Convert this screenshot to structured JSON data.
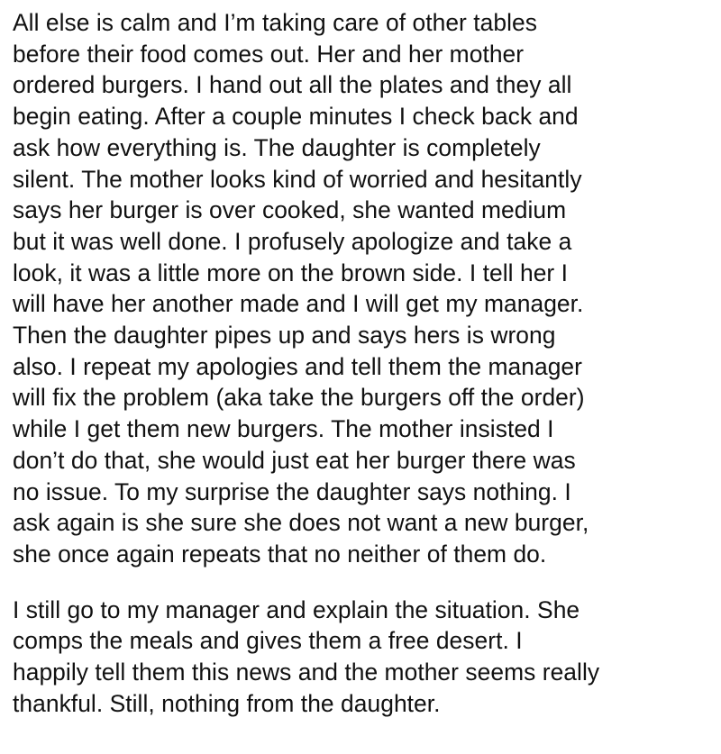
{
  "paragraphs": [
    {
      "lines": [
        "All else is calm and I’m taking care of other tables",
        "before their food comes out. Her and her mother",
        "ordered burgers. I hand out all the plates and they all",
        "begin eating. After a couple minutes I check back and",
        "ask how everything is. The daughter is completely",
        "silent. The mother looks kind of worried and hesitantly",
        "says her burger is over cooked, she wanted medium",
        "but it was well done. I profusely apologize and take a",
        "look, it was a little more on the brown side. I tell her I",
        "will have her another made and I will get my manager.",
        "Then the daughter pipes up and says hers is wrong",
        "also. I repeat my apologies and tell them the manager",
        "will fix the problem (aka take the burgers off the order)",
        "while I get them new burgers. The mother insisted I",
        "don’t do that, she would just eat her burger there was",
        "no issue. To my surprise the daughter says nothing. I",
        "ask again is she sure she does not want a new burger,",
        "she once again repeats that no neither of them do."
      ]
    },
    {
      "lines": [
        "I still go to my manager and explain the situation. She",
        "comps the meals and gives them a free desert. I",
        "happily tell them this news and the mother seems really",
        "thankful. Still, nothing from the daughter."
      ]
    }
  ]
}
